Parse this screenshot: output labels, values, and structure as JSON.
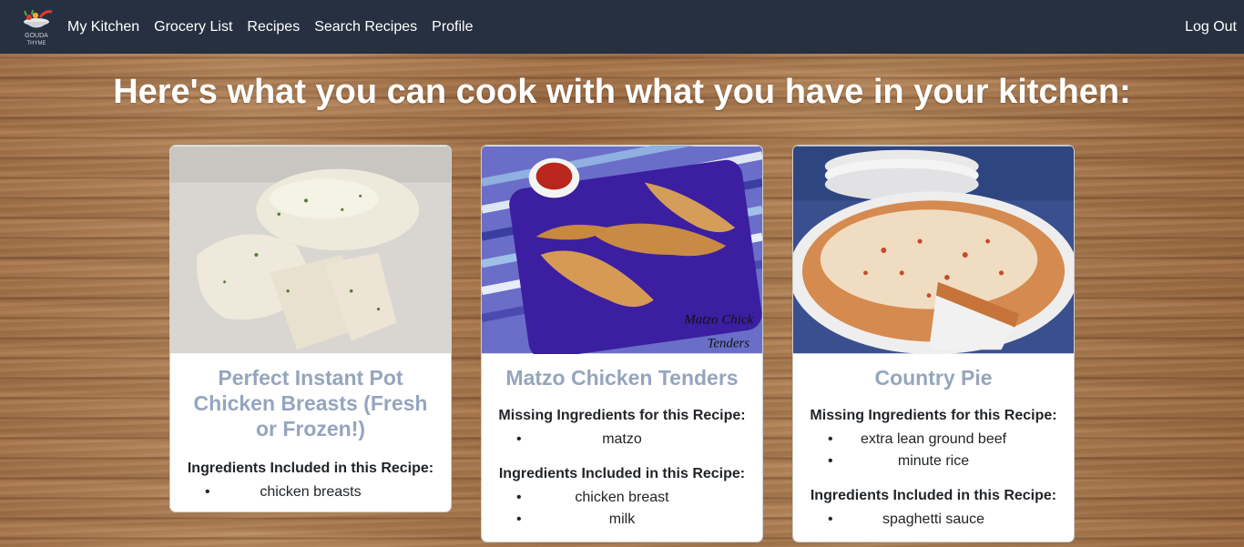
{
  "nav": {
    "logo_text": "GOUDA THYME",
    "links": [
      "My Kitchen",
      "Grocery List",
      "Recipes",
      "Search Recipes",
      "Profile"
    ],
    "logout": "Log Out"
  },
  "page": {
    "headline": "Here's what you can cook with what you have in your kitchen:"
  },
  "recipes": [
    {
      "title": "Perfect Instant Pot Chicken Breasts (Fresh or Frozen!)",
      "image": "chicken-breasts-photo",
      "included_label": "Ingredients Included in this Recipe:",
      "included": [
        "chicken breasts"
      ]
    },
    {
      "title": "Matzo Chicken Tenders",
      "image": "chicken-tenders-photo",
      "image_caption": "Matzo Chicken Tenders",
      "missing_label": "Missing Ingredients for this Recipe:",
      "missing": [
        "matzo"
      ],
      "included_label": "Ingredients Included in this Recipe:",
      "included": [
        "chicken breast",
        "milk"
      ]
    },
    {
      "title": "Country Pie",
      "image": "country-pie-photo",
      "missing_label": "Missing Ingredients for this Recipe:",
      "missing": [
        "extra lean ground beef",
        "minute rice"
      ],
      "included_label": "Ingredients Included in this Recipe:",
      "included": [
        "spaghetti sauce"
      ]
    }
  ],
  "colors": {
    "navbar": "#263040",
    "card_title": "#95a5be",
    "text": "#212529"
  }
}
